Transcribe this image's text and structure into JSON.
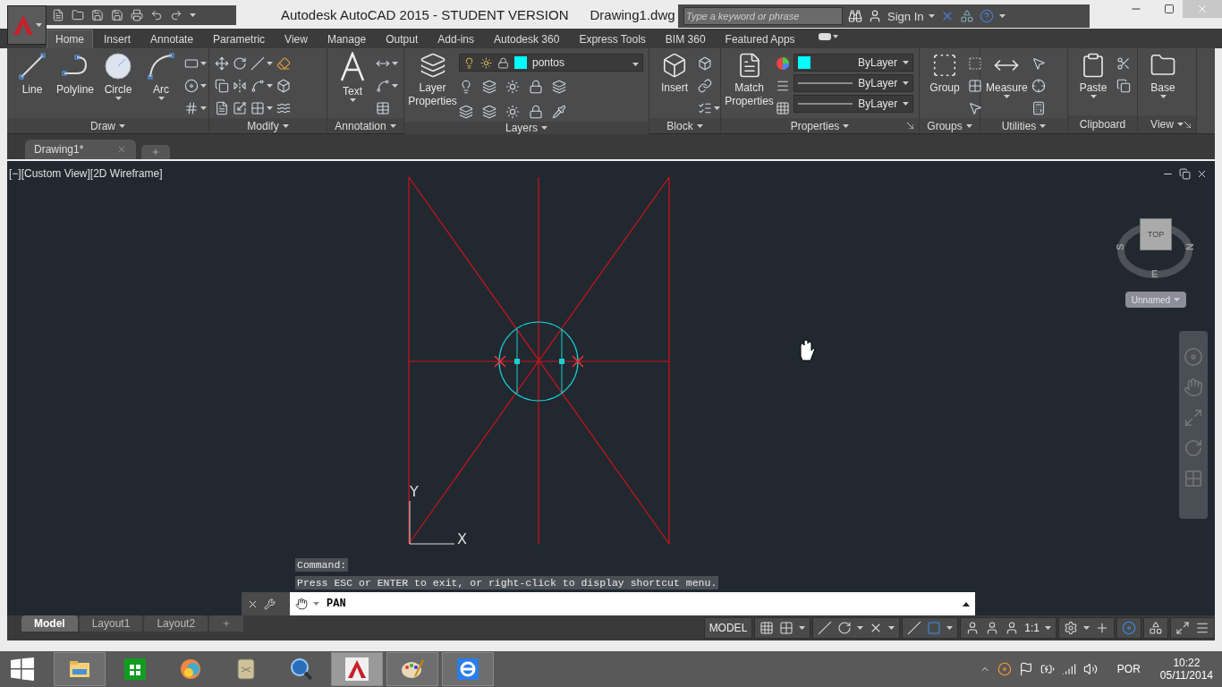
{
  "title_bar": {
    "app": "Autodesk AutoCAD 2015 - STUDENT VERSION",
    "document": "Drawing1.dwg",
    "search": {
      "placeholder": "Type a keyword or phrase"
    },
    "sign_in": "Sign In"
  },
  "ribbon_tabs": [
    {
      "label": "Home",
      "selected": true
    },
    {
      "label": "Insert",
      "selected": false
    },
    {
      "label": "Annotate",
      "selected": false
    },
    {
      "label": "Parametric",
      "selected": false
    },
    {
      "label": "View",
      "selected": false
    },
    {
      "label": "Manage",
      "selected": false
    },
    {
      "label": "Output",
      "selected": false
    },
    {
      "label": "Add-ins",
      "selected": false
    },
    {
      "label": "Autodesk 360",
      "selected": false
    },
    {
      "label": "Express Tools",
      "selected": false
    },
    {
      "label": "BIM 360",
      "selected": false
    },
    {
      "label": "Featured Apps",
      "selected": false
    }
  ],
  "ribbon_panels": [
    {
      "title": "Draw",
      "menu": true,
      "launcher": false,
      "tools": [
        {
          "label": "Line",
          "menu": false
        },
        {
          "label": "Polyline",
          "menu": false
        },
        {
          "label": "Circle",
          "menu": true
        },
        {
          "label": "Arc",
          "menu": true
        }
      ]
    },
    {
      "title": "Modify",
      "menu": true,
      "launcher": false
    },
    {
      "title": "Annotation",
      "menu": true,
      "launcher": false,
      "tools": [
        {
          "label": "Text",
          "menu": true
        }
      ]
    },
    {
      "title": "Layers",
      "menu": true,
      "launcher": false,
      "tools": [
        {
          "label": "Layer Properties",
          "menu": false
        }
      ],
      "layer": {
        "name": "pontos",
        "color": "#00ffff"
      }
    },
    {
      "title": "Block",
      "menu": true,
      "launcher": false,
      "tools": [
        {
          "label": "Insert",
          "menu": false
        }
      ]
    },
    {
      "title": "Properties",
      "menu": true,
      "launcher": true,
      "tools": [
        {
          "label": "Match Properties",
          "menu": false
        }
      ],
      "fields": [
        {
          "kind": "color",
          "value": "ByLayer",
          "color": "#00ffff"
        },
        {
          "kind": "line",
          "value": "ByLayer"
        },
        {
          "kind": "line",
          "value": "ByLayer"
        }
      ]
    },
    {
      "title": "Groups",
      "menu": true,
      "launcher": false,
      "tools": [
        {
          "label": "Group",
          "menu": false
        }
      ]
    },
    {
      "title": "Utilities",
      "menu": true,
      "launcher": false,
      "tools": [
        {
          "label": "Measure",
          "menu": true
        }
      ]
    },
    {
      "title": "Clipboard",
      "menu": false,
      "launcher": false,
      "tools": [
        {
          "label": "Paste",
          "menu": true
        }
      ]
    },
    {
      "title": "View",
      "menu": true,
      "launcher": true,
      "tools": [
        {
          "label": "Base",
          "menu": true
        }
      ]
    }
  ],
  "file_tabs": [
    {
      "label": "Drawing1*",
      "selected": true
    }
  ],
  "viewport": {
    "label": "[−][Custom View][2D Wireframe]",
    "view_cube": {
      "face": "TOP",
      "west": "S",
      "east": "N",
      "south": "E",
      "view": "Unnamed"
    },
    "ucs": {
      "y": "Y",
      "x": "X"
    }
  },
  "command_line": {
    "history": [
      "Command:",
      "Press ESC or ENTER to exit, or right-click to display shortcut menu."
    ],
    "value": "PAN"
  },
  "layout_tabs": [
    {
      "label": "Model",
      "selected": true
    },
    {
      "label": "Layout1",
      "selected": false
    },
    {
      "label": "Layout2",
      "selected": false
    }
  ],
  "status_bar": {
    "space": "MODEL",
    "scale": "1:1"
  },
  "taskbar": {
    "apps": [
      {
        "running": true,
        "selected": false
      },
      {
        "running": false,
        "selected": false
      },
      {
        "running": false,
        "selected": false
      },
      {
        "running": false,
        "selected": false
      },
      {
        "running": false,
        "selected": false
      },
      {
        "running": true,
        "selected": true
      },
      {
        "running": true,
        "selected": false
      },
      {
        "running": true,
        "selected": false
      }
    ],
    "language": "POR",
    "time": "10:22",
    "date": "05/11/2014"
  }
}
